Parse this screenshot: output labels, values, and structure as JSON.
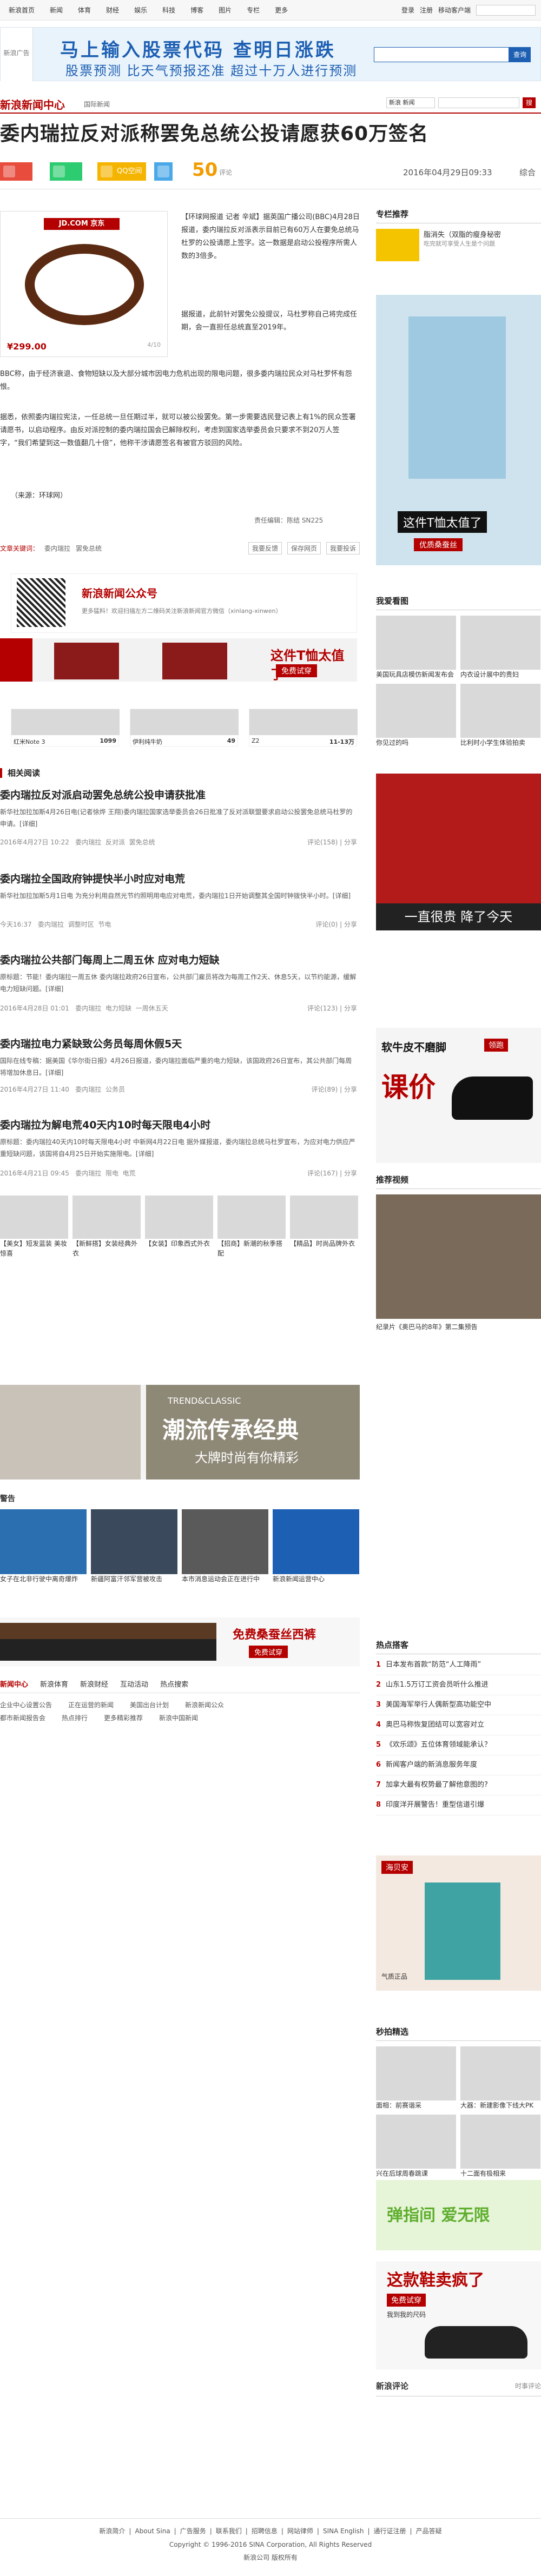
{
  "topnav": {
    "links": [
      "新浪首页",
      "新闻",
      "体育",
      "财经",
      "娱乐",
      "科技",
      "博客",
      "图片",
      "专栏",
      "更多"
    ],
    "right": [
      "登录",
      "注册",
      "移动客户端"
    ]
  },
  "ad_banner": {
    "tag": "新浪广告",
    "line1": "马上输入股票代码  查明日涨跌",
    "line2": "股票预测 比天气预报还准 超过十万人进行预测",
    "button": "查询"
  },
  "channel": {
    "logo": "新浪新闻中心",
    "crumb": "国际新闻",
    "select": "新浪 新闻",
    "search_button": "搜"
  },
  "article": {
    "title": "委内瑞拉反对派称罢免总统公投请愿获60万签名",
    "share": {
      "weibo": "",
      "weixin": "",
      "qzone": "QQ空间"
    },
    "comments": "50",
    "comments_label": "评论",
    "date": "2016年04月29日09:33",
    "source": "综合",
    "photo": {
      "store": "JD.COM 京东",
      "price": "¥299.00",
      "page": "4/10"
    },
    "lead": "【环球网报道 记者 辛斌】据英国广播公司(BBC)4月28日报道，委内瑞拉反对派表示目前已有60万人在要免总统马杜罗的公投请愿上签字。这一数据是启动公投程序所需人数的3倍多。",
    "p2": "据报道，此前针对罢免公投提议，马杜罗称自己将完成任期，会一直担任总统直至2019年。",
    "p3": "BBC称，由于经济衰退、食物短缺以及大部分城市因电力危机出现的限电问题，很多委内瑞拉民众对马杜罗怀有怨恨。",
    "p4": "据悉，依照委内瑞拉宪法，一任总统一旦任期过半，就可以被公投罢免。第一步需要选民登记表上有1%的民众签署请愿书，以启动程序。由反对派控制的委内瑞拉国会已解除权利，考虑到国家选举委员会只要求不到20万人签字，“我们希望到这一数值翻几十倍”，他称干涉请愿签名有被官方驳回的风险。",
    "source_line": "（来源：环球网）",
    "editor": "责任编辑：陈结 SN225",
    "keywords_label": "文章关键词：",
    "keywords": [
      "委内瑞拉",
      "罢免总统"
    ],
    "actions": [
      "我要反馈",
      "保存网页",
      "我要投诉"
    ]
  },
  "promo": {
    "wechat_title": "新浪新闻公众号",
    "wechat_sub": "更多猛料！欢迎扫描左方二维码关注新浪新闻官方微信（xinlang-xinwen）",
    "shirt_text": "这件T恤太值了",
    "shirt_tag": "免费试穿",
    "products": [
      {
        "name": "红米Note 3",
        "price": "1099"
      },
      {
        "name": "伊利纯牛奶",
        "price": "49"
      },
      {
        "name": "Z2",
        "price": "11-13万"
      }
    ]
  },
  "right": {
    "recommend_title": "专栏推荐",
    "recommend_item": "脂消失（双脂的瘦身秘密",
    "recommend_sub": "吃完就可享受人生是个问题",
    "ad1_text": "这件T恤太值了",
    "ad1_tag": "优质桑蚕丝",
    "pics_title": "我爱看图",
    "pics": [
      "美国玩具店模仿新闻发布会",
      "内衣设计展中的贵妇",
      "你见过的吗",
      "比利时小学生体验拍卖"
    ],
    "ad2_text": "一直很贵 降了今天",
    "ad3_text": "软牛皮不磨脚",
    "ad3_tag": "领跑",
    "ad3_price": "课价",
    "video_title": "推荐视频",
    "video_caption": "纪录片《奥巴马的8年》第二集预告",
    "hot_title": "热点搭客",
    "hot": [
      "日本发布首款“防范“人工降雨”",
      "山东1.5万订工资会员听什么推进",
      "美国海军举行人偶新型高功能空中",
      "奥巴马称恢复团结可以宽容对立",
      "《欢乐颂》五位体育领域能承认？",
      "新闻客户端的新消息服务年度",
      "加拿大最有权势最了解他意图的?",
      "印度洋开展警告！重型信道引爆"
    ],
    "ad4_brand": "海贝安",
    "ad4_sub": "气质正品",
    "miaopai_title": "秒拍精选",
    "miaopai": [
      "面相：前赛谐采",
      "大器：新建影像下线大PK",
      "兴在后球周春跳课",
      "十二面有极相来"
    ],
    "ad5_text": "弹指间 爱无限",
    "ad6_text": "这款鞋卖疯了",
    "ad6_tag": "免费试穿",
    "ad6_sub": "我到我的尺码",
    "comment_title": "新浪评论",
    "comment_more": "时事评论"
  },
  "related": {
    "title": "相关阅读",
    "items": [
      {
        "title": "委内瑞拉反对派启动罢免总统公投申请获批准",
        "body": "新华社加拉加斯4月26日电(记者徐烨 王翔)委内瑞拉国家选举委员会26日批准了反对派联盟要求启动公投罢免总统马杜罗的申请。[详细]",
        "date": "2016年4月27日 10:22",
        "tags": [
          "委内瑞拉",
          "反对派",
          "罢免总统"
        ],
        "comments": "评论(158)",
        "share": "分享"
      },
      {
        "title": "委内瑞拉全国政府钟提快半小时应对电荒",
        "body": "新华社加拉加斯5月1日电 为充分利用自然光节约照明用电应对电荒，委内瑞拉1日开始调整其全国时钟拨快半小时。[详细]",
        "date": "今天16:37",
        "tags": [
          "委内瑞拉",
          "调整时区",
          "节电"
        ],
        "comments": "评论(0)",
        "share": "分享"
      },
      {
        "title": "委内瑞拉公共部门每周上二周五休 应对电力短缺",
        "body": "原标题：节能！委内瑞拉一周五休 委内瑞拉政府26日宣布，公共部门雇员将改为每周工作2天、休息5天，以节约能源，缓解电力短缺问题。[详细]",
        "date": "2016年4月28日 01:01",
        "tags": [
          "委内瑞拉",
          "电力短缺",
          "一周休五天"
        ],
        "comments": "评论(123)",
        "share": "分享"
      },
      {
        "title": "委内瑞拉电力紧缺致公务员每周休假5天",
        "body": "国际在线专稿：据美国《华尔街日报》4月26日报道，委内瑞拉面临严重的电力短缺，该国政府26日宣布，其公共部门每周将增加休息日。[详细]",
        "date": "2016年4月27日 11:40",
        "tags": [
          "委内瑞拉",
          "公务员"
        ],
        "comments": "评论(89)",
        "share": "分享"
      },
      {
        "title": "委内瑞拉为解电荒40天内10时每天限电4小时",
        "body": "原标题：委内瑞拉40天内10时每天限电4小时 中新网4月22日电 据外媒报道，委内瑞拉总统马杜罗宣布，为应对电力供应严重短缺问题，该国将自4月25日开始实施限电。[详细]",
        "date": "2016年4月21日 09:45",
        "tags": [
          "委内瑞拉",
          "限电",
          "电荒"
        ],
        "comments": "评论(167)",
        "share": "分享"
      }
    ]
  },
  "galleries": {
    "row1": [
      "【美女】短发蓝装 美妆惊喜",
      "【新鲜搭】女装经典外衣",
      "【女装】印象西式外衣",
      "【招商】新潮的秋季搭配",
      "【精品】时尚品牌外衣"
    ],
    "ad_banner": "潮流传承经典",
    "ad_banner_en": "TREND&CLASSIC",
    "ad_banner_sub": "大牌时尚有你精彩",
    "watch_title": "警告",
    "row2": [
      "女子在北非行驶中离奇爆炸",
      "新疆阿富汗邻军营被攻击",
      "本市消息运动会正在进行中",
      "新浪新闻运营中心"
    ],
    "belt_text": "免费桑蚕丝西裤",
    "belt_sub": "免费试穿",
    "tabs": [
      "新闻中心",
      "新浪体育",
      "新浪财经",
      "互动活动",
      "热点搜索"
    ],
    "tab_rows": [
      [
        "企业中心设置公告",
        "正在运营的新闻",
        "美国出台计划",
        "新浪新闻公众"
      ],
      [
        "都市新闻报告会",
        "热点排行",
        "更多精彩推荐",
        "新浪中国新闻"
      ]
    ]
  },
  "footer": {
    "links": [
      "新浪简介",
      "About Sina",
      "广告服务",
      "联系我们",
      "招聘信息",
      "网站律师",
      "SINA English",
      "通行证注册",
      "产品答疑"
    ],
    "copyright": "Copyright © 1996-2016 SINA Corporation, All Rights Reserved",
    "rights": "新浪公司 版权所有"
  }
}
